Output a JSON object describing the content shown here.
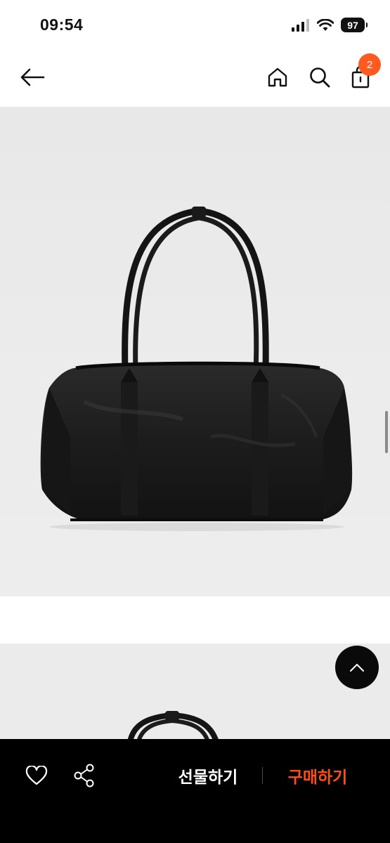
{
  "status_bar": {
    "time": "09:54",
    "battery": "97",
    "icons": [
      "signal-icon",
      "wifi-icon",
      "battery-icon"
    ]
  },
  "top_nav": {
    "icons": [
      "back-arrow-icon",
      "home-icon",
      "search-icon",
      "shopping-bag-icon"
    ],
    "cart_count": "2"
  },
  "product": {
    "images": [
      "black leather shoulder bag",
      "black leather shoulder bag (second image, partially visible)"
    ]
  },
  "bottom_bar": {
    "gift_label": "선물하기",
    "buy_label": "구매하기",
    "icons": [
      "heart-icon",
      "share-icon"
    ]
  },
  "colors": {
    "accent": "#ff4d16",
    "badge": "#ff5a1f",
    "bottom_bar_bg": "#000000"
  }
}
